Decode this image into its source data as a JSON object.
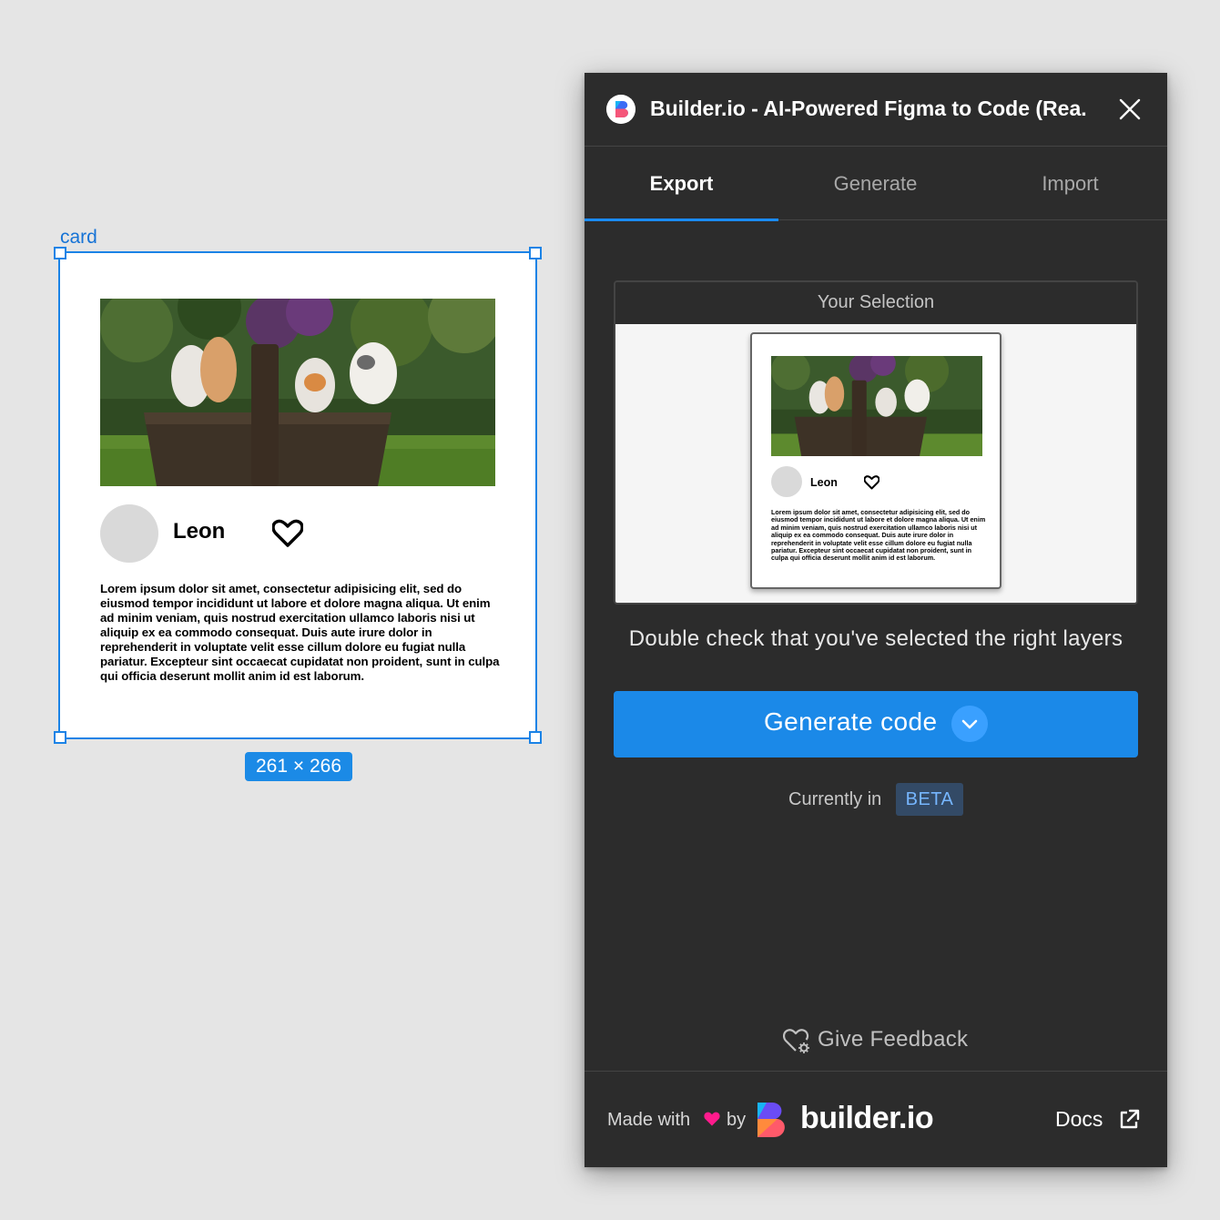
{
  "canvas": {
    "frame_label": "card",
    "size_badge": "261 × 266",
    "card": {
      "name": "Leon",
      "body": "Lorem ipsum dolor sit amet, consectetur adipisicing elit, sed do eiusmod tempor incididunt ut labore et dolore magna aliqua. Ut enim ad minim veniam, quis nostrud exercitation ullamco laboris nisi ut aliquip ex ea commodo consequat. Duis aute irure dolor in reprehenderit in voluptate velit esse cillum dolore eu fugiat nulla pariatur. Excepteur sint occaecat cupidatat non proident, sunt in culpa qui officia deserunt mollit anim id est laborum."
    }
  },
  "plugin": {
    "title": "Builder.io - AI-Powered Figma to Code (Rea...",
    "tabs": [
      "Export",
      "Generate",
      "Import"
    ],
    "active_tab": "Export",
    "selection_heading": "Your Selection",
    "hint": "Double check that you've selected the right layers",
    "generate_button": "Generate code",
    "currently_in": "Currently in",
    "beta_badge": "BETA",
    "feedback": "Give Feedback",
    "footer": {
      "made_with": "Made with",
      "by": "by",
      "brand": "builder.io",
      "docs": "Docs"
    },
    "icons": [
      "builder-logo-icon",
      "close-icon",
      "chevron-down-icon",
      "heart-gear-icon",
      "heart-icon",
      "external-link-icon"
    ]
  },
  "colors": {
    "accent": "#1b89e8",
    "selection": "#1b83e6",
    "heart_pink": "#ff1b8d",
    "panel_bg": "#2c2c2c"
  }
}
